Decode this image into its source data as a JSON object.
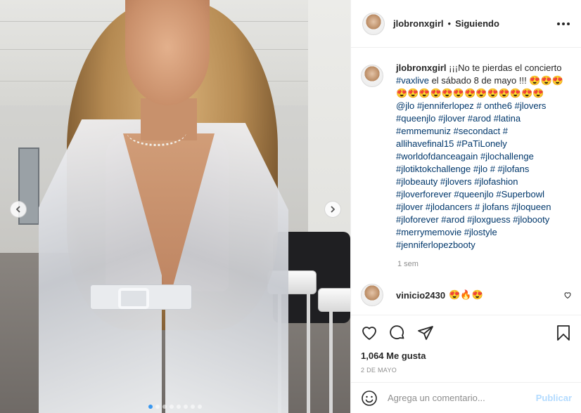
{
  "post": {
    "dots_total": 8,
    "dots_active_index": 0
  },
  "header": {
    "username": "jlobronxgirl",
    "separator": "•",
    "follow_status": "Siguiendo"
  },
  "caption": {
    "username": "jlobronxgirl",
    "text": "¡¡¡No te pierdas el concierto ",
    "hashtags_line1": "#vaxlive",
    "text2": " el sábado 8 de mayo !!! 😍😍😍😍😍😍😍😍😍😍😍😍😍😍😍😍 ",
    "mention": "@jlo",
    "hashtags_rest": "#jenniferlopez # onthe6 #jlovers #queenjlo #jlover #arod #latina #emmemuniz #secondact # allihavefinal15 #PaTiLonely #worldofdanceagain #jlochallenge #jlotiktokchallenge #jlo # #jlofans #jlobeauty #jlovers #jlofashion #jloverforever #queenjlo #Superbowl #jlover #jlodancers # jlofans #jloqueen #jloforever #arod #jloxguess #jlobooty #merrymemovie #jlostyle #jenniferlopezbooty",
    "time_ago": "1 sem"
  },
  "comment2": {
    "username": "vinicio2430",
    "text": "😍🔥😍"
  },
  "actions": {
    "likes": "1,064 Me gusta",
    "date": "2 DE MAYO"
  },
  "add_comment": {
    "placeholder": "Agrega un comentario...",
    "publish_label": "Publicar"
  },
  "colors": {
    "link": "#00376b",
    "publish_disabled": "#b3dbff",
    "active_dot": "#3897f0"
  }
}
